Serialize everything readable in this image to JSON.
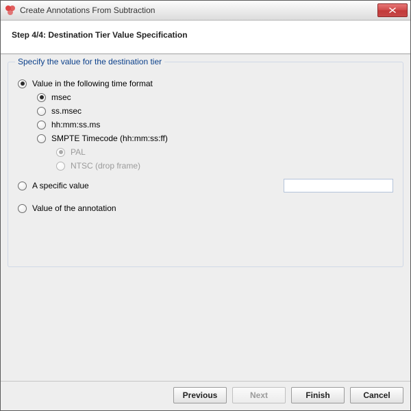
{
  "window": {
    "title": "Create Annotations From Subtraction"
  },
  "header": {
    "step": "Step 4/4: Destination Tier Value Specification"
  },
  "group": {
    "legend": "Specify the value for the destination tier",
    "options": {
      "time_format": {
        "label": "Value in the following time format",
        "selected": true,
        "formats": {
          "msec": {
            "label": "msec",
            "selected": true
          },
          "ssmsec": {
            "label": "ss.msec",
            "selected": false
          },
          "hhmmss": {
            "label": "hh:mm:ss.ms",
            "selected": false
          },
          "smpte": {
            "label": "SMPTE Timecode (hh:mm:ss:ff)",
            "selected": false,
            "sub": {
              "pal": {
                "label": "PAL",
                "selected": true,
                "enabled": false
              },
              "ntsc": {
                "label": "NTSC (drop frame)",
                "selected": false,
                "enabled": false
              }
            }
          }
        }
      },
      "specific_value": {
        "label": "A specific value",
        "selected": false,
        "input_value": ""
      },
      "annotation_value": {
        "label": "Value of the annotation",
        "selected": false
      }
    }
  },
  "buttons": {
    "previous": "Previous",
    "next": "Next",
    "finish": "Finish",
    "cancel": "Cancel"
  }
}
